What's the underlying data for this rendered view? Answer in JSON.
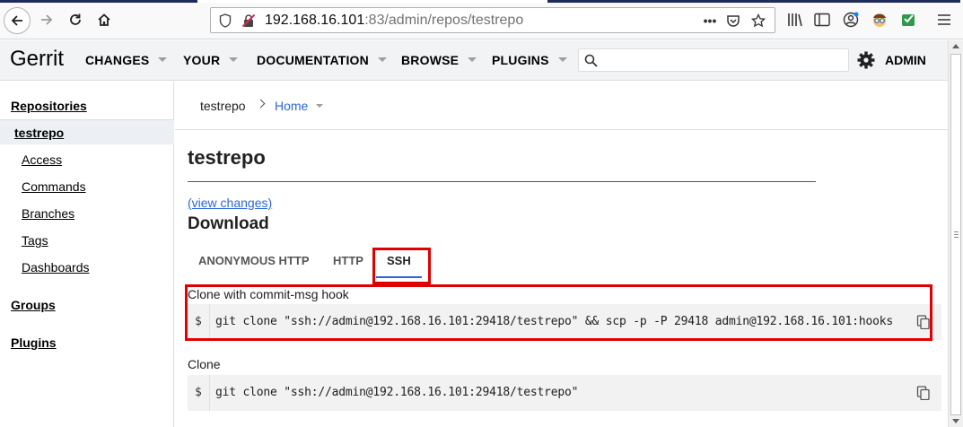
{
  "browser": {
    "url_host": "192.168.16.101",
    "url_rest": ":83/admin/repos/testrepo",
    "page_actions_label": "•••"
  },
  "header": {
    "logo": "Gerrit",
    "menu": [
      {
        "label": "CHANGES"
      },
      {
        "label": "YOUR"
      },
      {
        "label": "DOCUMENTATION"
      },
      {
        "label": "BROWSE"
      },
      {
        "label": "PLUGINS"
      }
    ],
    "search_placeholder": "",
    "user_label": "ADMIN"
  },
  "sidebar": {
    "repositories_label": "Repositories",
    "current_repo": "testrepo",
    "items": [
      {
        "label": "Access"
      },
      {
        "label": "Commands"
      },
      {
        "label": "Branches"
      },
      {
        "label": "Tags"
      },
      {
        "label": "Dashboards"
      }
    ],
    "groups_label": "Groups",
    "plugins_label": "Plugins"
  },
  "main": {
    "breadcrumb": {
      "repo": "testrepo",
      "current": "Home"
    },
    "title": "testrepo",
    "view_changes": "(view changes)",
    "download_heading": "Download",
    "tabs": [
      {
        "label": "ANONYMOUS HTTP"
      },
      {
        "label": "HTTP"
      },
      {
        "label": "SSH",
        "active": true
      }
    ],
    "commands": [
      {
        "label": "Clone with commit-msg hook",
        "prompt": "$",
        "text": "git clone \"ssh://admin@192.168.16.101:29418/testrepo\" && scp -p -P 29418 admin@192.168.16.101:hooks"
      },
      {
        "label": "Clone",
        "prompt": "$",
        "text": "git clone \"ssh://admin@192.168.16.101:29418/testrepo\""
      }
    ]
  },
  "colors": {
    "link": "#2a66d9",
    "highlight": "#e00000",
    "header_bg": "#f1f3f4"
  }
}
